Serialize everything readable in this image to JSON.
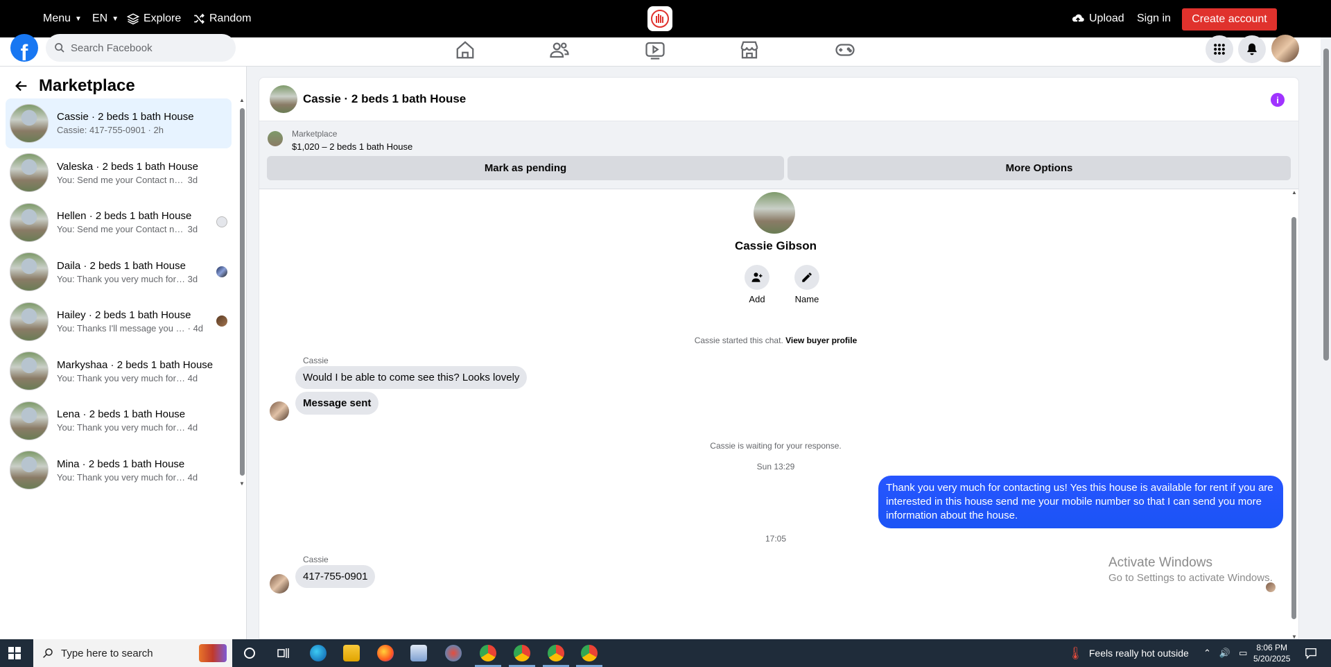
{
  "topbar": {
    "menu": "Menu",
    "lang": "EN",
    "explore": "Explore",
    "random": "Random",
    "upload": "Upload",
    "signin": "Sign in",
    "create": "Create account"
  },
  "fbheader": {
    "logo_letter": "f",
    "search_placeholder": "Search Facebook"
  },
  "left": {
    "title": "Marketplace",
    "conversations": [
      {
        "title": "Cassie · 2 beds 1 bath House",
        "preview": "Cassie: 417-755-0901",
        "time": "· 2h",
        "active": true
      },
      {
        "title": "Valeska · 2 beds 1 bath House",
        "preview": "You: Send me your Contact number...",
        "time": "3d"
      },
      {
        "title": "Hellen · 2 beds 1 bath House",
        "preview": "You: Send me your Contact num...",
        "time": "3d"
      },
      {
        "title": "Daila · 2 beds 1 bath House",
        "preview": "You: Thank you very much for co...",
        "time": "3d"
      },
      {
        "title": "Hailey · 2 beds 1 bath House",
        "preview": "You: Thanks I'll message you in ...",
        "time": "· 4d"
      },
      {
        "title": "Markyshaa · 2 beds 1 bath House",
        "preview": "You: Thank you very much for cont...",
        "time": "4d"
      },
      {
        "title": "Lena · 2 beds 1 bath House",
        "preview": "You: Thank you very much for cont...",
        "time": "4d"
      },
      {
        "title": "Mina · 2 beds 1 bath House",
        "preview": "You: Thank you very much for cont...",
        "time": "4d"
      }
    ]
  },
  "chat": {
    "title": "Cassie · 2 beds 1 bath House",
    "listing_source": "Marketplace",
    "listing_price": "$1,020 – 2 beds 1 bath House",
    "mark_pending": "Mark as pending",
    "more_options": "More Options",
    "profile_name": "Cassie Gibson",
    "btn_add": "Add",
    "btn_name": "Name",
    "started": "Cassie started this chat.",
    "view_profile": "View buyer profile",
    "sender1": "Cassie",
    "msg1": "Would I be able to come see this? Looks lovely",
    "msg2": "Message sent",
    "waiting": "Cassie is waiting for your response.",
    "time1": "Sun 13:29",
    "msg_out": "Thank you very much for contacting us! Yes this house is available for rent if you are interested in this house send me your mobile number so that I can send you more information about the house.",
    "time2": "17:05",
    "sender2": "Cassie",
    "msg3": "417-755-0901"
  },
  "watermark": {
    "line1": "Activate Windows",
    "line2": "Go to Settings to activate Windows."
  },
  "taskbar": {
    "search_placeholder": "Type here to search",
    "weather": "Feels really hot outside",
    "time": "8:06 PM",
    "date": "5/20/2025"
  },
  "colors": {
    "brand": "#1877f2",
    "outgoing_bubble": "#2755ff",
    "create_account": "#e0322d",
    "info_icon": "#a033ff"
  }
}
